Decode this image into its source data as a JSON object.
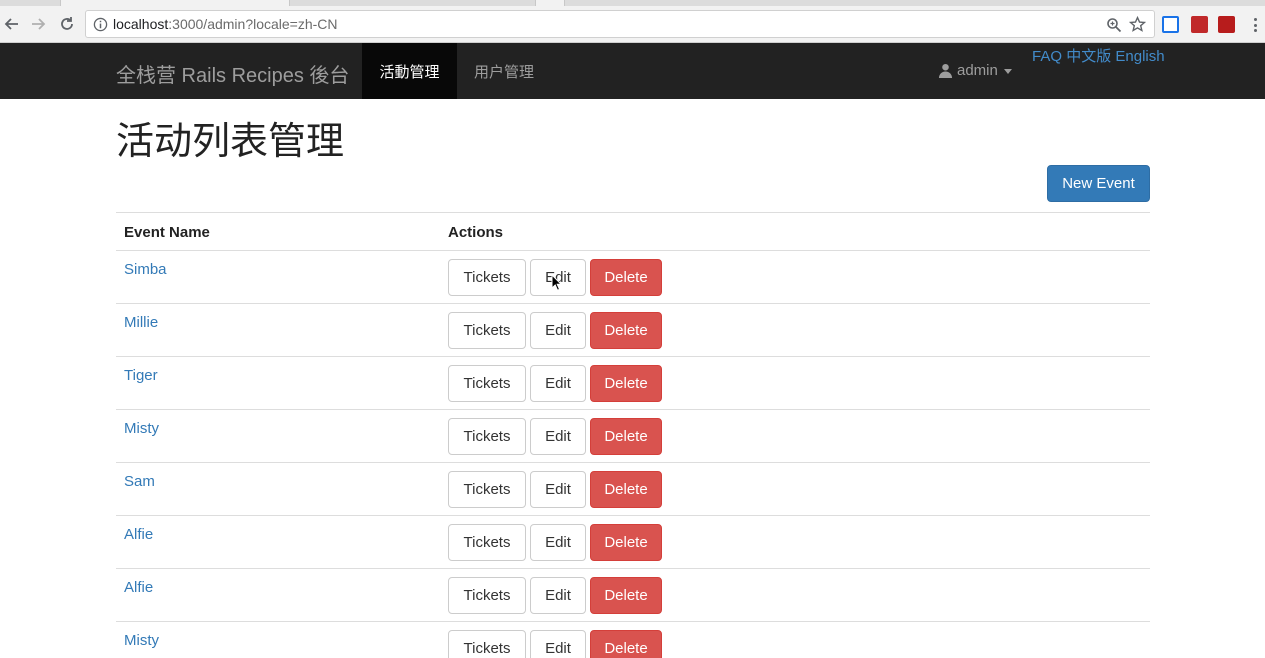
{
  "browser": {
    "url_host": "localhost",
    "url_rest": ":3000/admin?locale=zh-CN"
  },
  "navbar": {
    "brand": "全栈营 Rails Recipes 後台",
    "items": [
      {
        "label": "活動管理",
        "active": true
      },
      {
        "label": "用户管理",
        "active": false
      }
    ],
    "user": "admin",
    "locale_links": [
      "FAQ",
      "中文版",
      "English"
    ]
  },
  "page": {
    "title": "活动列表管理",
    "new_button": "New Event"
  },
  "table": {
    "headers": [
      "Event Name",
      "Actions"
    ],
    "rows": [
      {
        "name": "Simba"
      },
      {
        "name": "Millie"
      },
      {
        "name": "Tiger"
      },
      {
        "name": "Misty"
      },
      {
        "name": "Sam"
      },
      {
        "name": "Alfie"
      },
      {
        "name": "Alfie"
      },
      {
        "name": "Misty"
      }
    ],
    "action_labels": {
      "tickets": "Tickets",
      "edit": "Edit",
      "delete": "Delete"
    }
  },
  "colors": {
    "primary": "#337ab7",
    "danger": "#d9534f",
    "navbar": "#222222"
  }
}
